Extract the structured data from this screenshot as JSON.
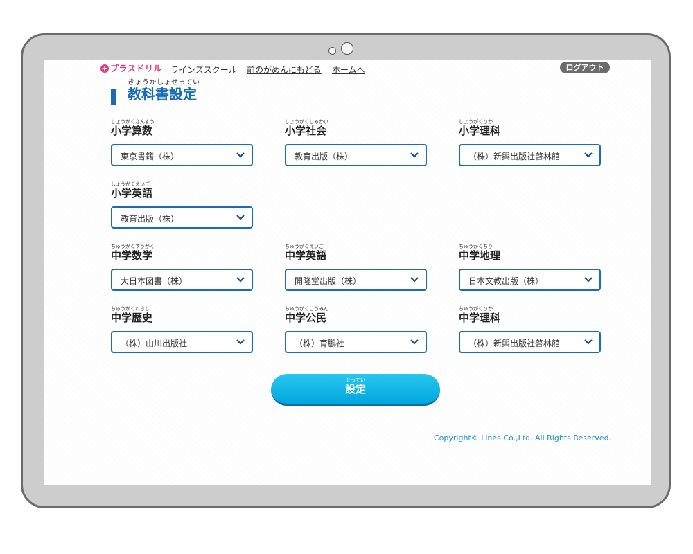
{
  "header": {
    "logo_text": "プラスドリル",
    "links": [
      "ラインズスクール",
      "前のがめんにもどる",
      "ホームへ"
    ],
    "logout_label": "ログアウト"
  },
  "page": {
    "title_ruby": "きょうかしょせってい",
    "title": "教科書設定"
  },
  "fields": [
    {
      "ruby": "しょうがくさんすう",
      "label": "小学算数",
      "value": "東京書籍（株）"
    },
    {
      "ruby": "しょうがくしゃかい",
      "label": "小学社会",
      "value": "教育出版（株）"
    },
    {
      "ruby": "しょうがくりか",
      "label": "小学理科",
      "value": "（株）新興出版社啓林館"
    },
    {
      "ruby": "しょうがくえいご",
      "label": "小学英語",
      "value": "教育出版（株）"
    },
    {
      "ruby": "ちゅうがくすうがく",
      "label": "中学数学",
      "value": "大日本図書（株）"
    },
    {
      "ruby": "ちゅうがくえいご",
      "label": "中学英語",
      "value": "開隆堂出版（株）"
    },
    {
      "ruby": "ちゅうがくちり",
      "label": "中学地理",
      "value": "日本文教出版（株）"
    },
    {
      "ruby": "ちゅうがくれきし",
      "label": "中学歴史",
      "value": "（株）山川出版社"
    },
    {
      "ruby": "ちゅうがくこうみん",
      "label": "中学公民",
      "value": "（株）育鵬社"
    },
    {
      "ruby": "ちゅうがくりか",
      "label": "中学理科",
      "value": "（株）新興出版社啓林館"
    }
  ],
  "submit": {
    "ruby": "せってい",
    "label": "設定"
  },
  "footer": {
    "copyright": "Copyright© Lines Co.,Ltd. All Rights Reserved."
  },
  "colors": {
    "accent": "#1a6db5",
    "button": "#00a7dc",
    "logo": "#e6397a",
    "copyright": "#1f8fd0"
  }
}
